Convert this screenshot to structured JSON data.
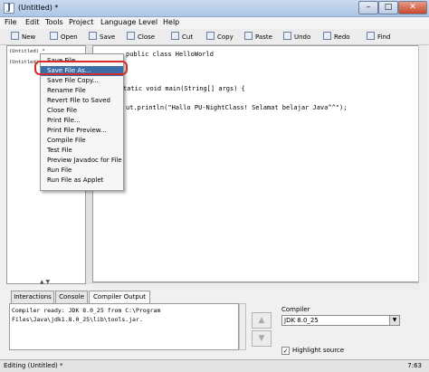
{
  "window": {
    "title": "(Untitled) *",
    "app_icon": "J"
  },
  "menubar": [
    "File",
    "Edit",
    "Tools",
    "Project",
    "Language Level",
    "Help"
  ],
  "toolbar": [
    {
      "label": "New",
      "icon": "new-icon"
    },
    {
      "label": "Open",
      "icon": "open-icon"
    },
    {
      "label": "Save",
      "icon": "save-icon"
    },
    {
      "label": "Close",
      "icon": "close-icon"
    },
    {
      "label": "Cut",
      "icon": "cut-icon"
    },
    {
      "label": "Copy",
      "icon": "copy-icon"
    },
    {
      "label": "Paste",
      "icon": "paste-icon"
    },
    {
      "label": "Undo",
      "icon": "undo-icon"
    },
    {
      "label": "Redo",
      "icon": "redo-icon"
    },
    {
      "label": "Find",
      "icon": "find-icon"
    }
  ],
  "left_panel": {
    "doc_header": "(Untitled) *",
    "doc_item": "(Untitled)"
  },
  "editor": {
    "line1": "public class HelloWorld",
    "line2": "tatic void main(String[] args) {",
    "line3": "ut.println(\"Hallo PU-NightClass! Selamat belajar Java^^\");"
  },
  "context_menu": {
    "items": [
      "Save File",
      "Save File As...",
      "Save File Copy...",
      "Rename File",
      "Revert File to Saved",
      "Close File",
      "Print File...",
      "Print File Preview...",
      "Compile File",
      "Test File",
      "Preview Javadoc for File",
      "Run File",
      "Run File as Applet"
    ],
    "highlighted": "Save File As..."
  },
  "bottom_tabs": [
    "Interactions",
    "Console",
    "Compiler Output"
  ],
  "active_tab": "Compiler Output",
  "output": {
    "line1": "Compiler ready: JDK 8.0_25 from C:\\Program",
    "line2": "Files\\Java\\jdk1.8.0_25\\lib\\tools.jar."
  },
  "compiler_panel": {
    "label": "Compiler",
    "selected": "JDK 8.0_25",
    "highlight_source": "Highlight source",
    "highlight_checked": true
  },
  "status": {
    "left": "Editing (Untitled) *",
    "right": "7:63"
  },
  "colors": {
    "menu_highlight": "#3d6da8",
    "annotation_ring": "#d92a2a",
    "close_button": "#c9472c"
  }
}
